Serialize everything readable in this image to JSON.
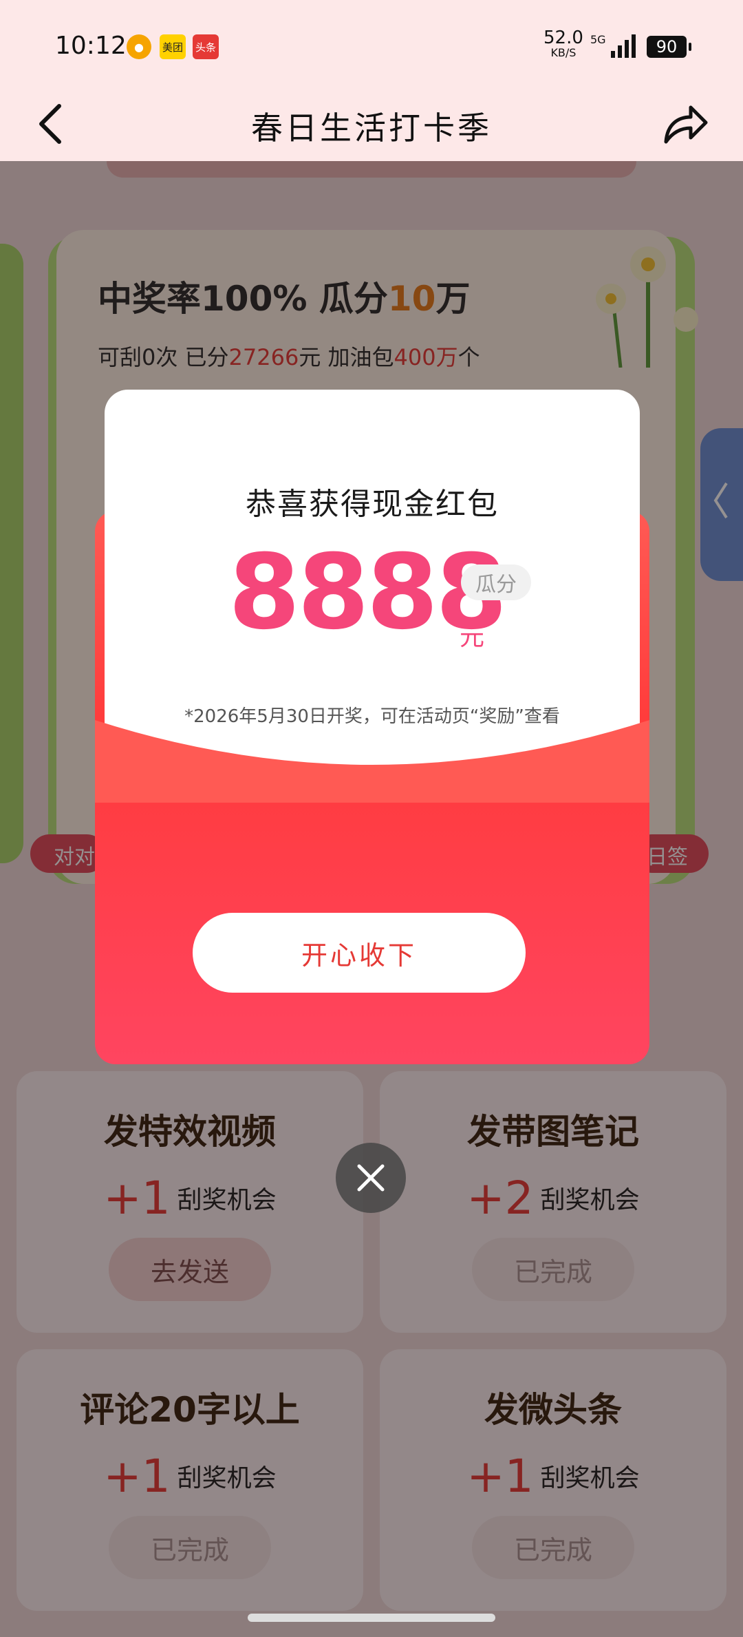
{
  "status_bar": {
    "time": "10:12",
    "notif_icons": [
      "app-icon",
      "美团",
      "头条"
    ],
    "net_speed": "52.0",
    "net_unit": "KB/S",
    "signal": "5G",
    "battery": "90"
  },
  "header": {
    "title": "春日生活打卡季"
  },
  "card": {
    "title_prefix": "中奖率100%  瓜分",
    "title_highlight": "10",
    "title_suffix": "万",
    "sub_prefix": "可刮0次  已分",
    "sub_amount": "27266",
    "sub_mid": "元  加油包",
    "sub_pack": "400万",
    "sub_suffix": "个"
  },
  "pills": {
    "left": "对对",
    "right": "日签"
  },
  "tasks": [
    {
      "title": "发特效视频",
      "plus": "+1",
      "reward": "刮奖机会",
      "button": "去发送"
    },
    {
      "title": "发带图笔记",
      "plus": "+2",
      "reward": "刮奖机会",
      "button": "已完成"
    },
    {
      "title": "评论20字以上",
      "plus": "+1",
      "reward": "刮奖机会",
      "button": "已完成"
    },
    {
      "title": "发微头条",
      "plus": "+1",
      "reward": "刮奖机会",
      "button": "已完成"
    }
  ],
  "modal": {
    "title": "恭喜获得现金红包",
    "amount": "8888",
    "unit": "元",
    "badge": "瓜分",
    "note": "*2026年5月30日开奖，可在活动页“奖励”查看",
    "accept_button": "开心收下"
  },
  "colors": {
    "accent_red": "#e53935",
    "amount_pink": "#f5467a",
    "header_bg": "#fde8e8"
  }
}
